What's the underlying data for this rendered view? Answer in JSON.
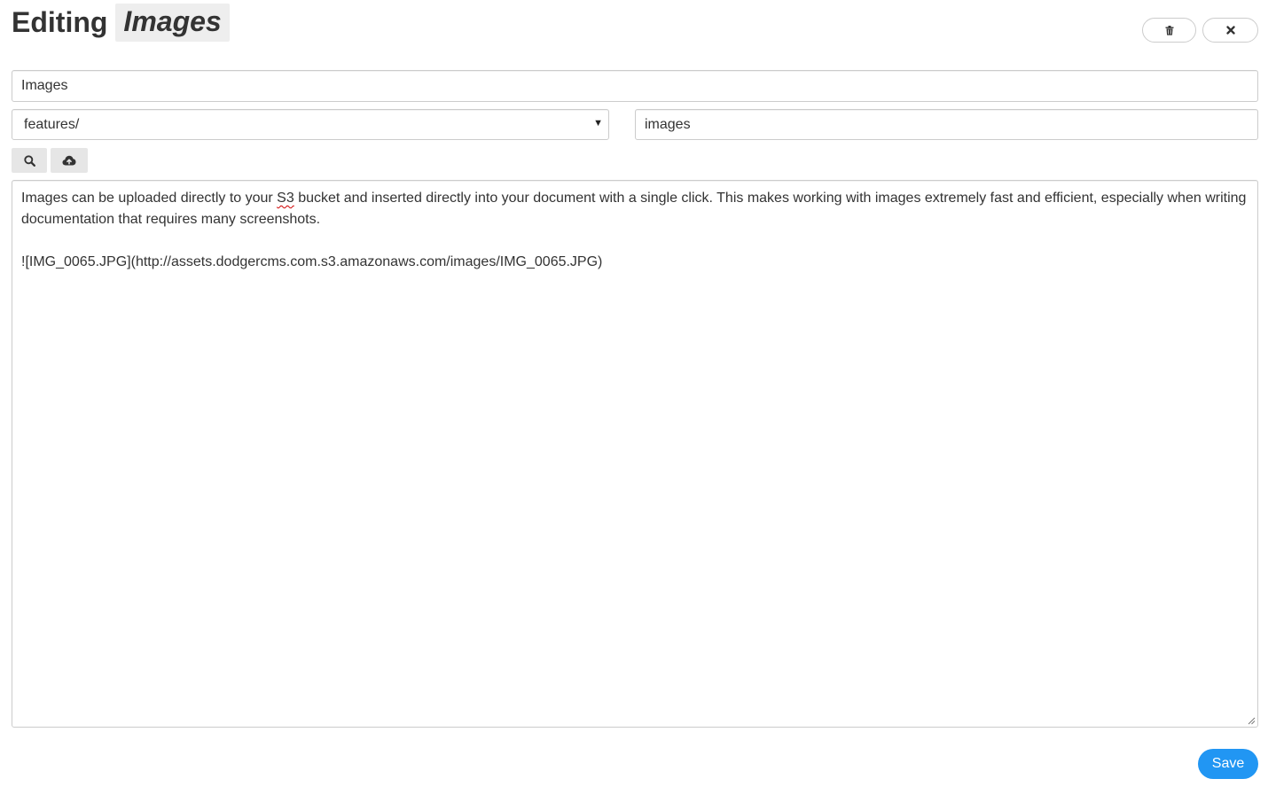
{
  "header": {
    "title_prefix": "Editing",
    "document_name": "Images",
    "delete_icon": "trash-icon",
    "close_icon": "close-icon"
  },
  "form": {
    "title_value": "Images",
    "folder_selected": "features/",
    "slug_value": "images",
    "toolbar": {
      "search_icon": "search-icon",
      "upload_icon": "cloud-upload-icon"
    },
    "body": {
      "paragraph_before": "Images can be uploaded directly to your ",
      "misspelled_word": "S3",
      "paragraph_after": " bucket and inserted directly into your document with a single click. This makes working with images extremely fast and efficient, especially when writing documentation that requires many screenshots.",
      "image_markdown": "![IMG_0065.JPG](http://assets.dodgercms.com.s3.amazonaws.com/images/IMG_0065.JPG)"
    },
    "save_label": "Save"
  },
  "colors": {
    "primary": "#2196f3",
    "border": "#cccccc",
    "toolbar_button": "#e6e6e6",
    "title_highlight": "#eeeeee"
  }
}
